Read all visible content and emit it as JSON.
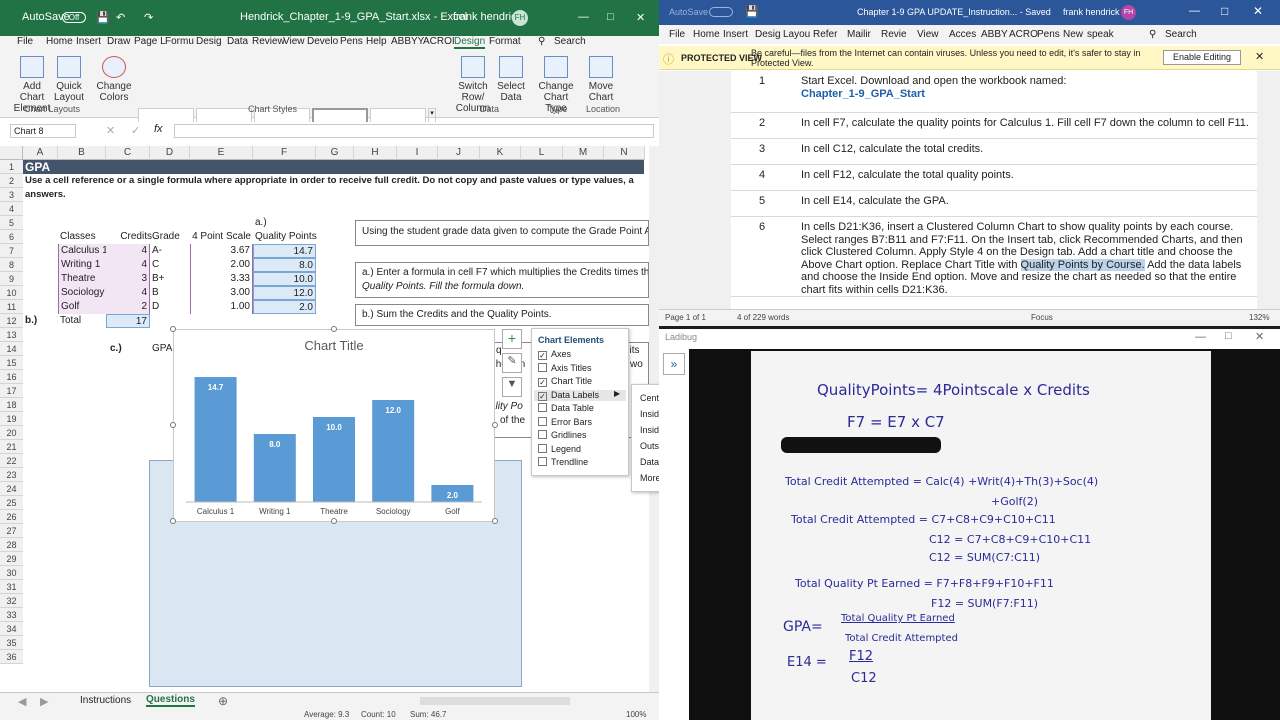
{
  "excel": {
    "autosave": "AutoSave",
    "autosave_state": "Off",
    "title": "Hendrick_Chapter_1-9_GPA_Start.xlsx - Excel",
    "user": "frank hendrick",
    "initials": "FH",
    "tabs": [
      "File",
      "Home",
      "Insert",
      "Draw",
      "Page L",
      "Formu",
      "Desig",
      "Data",
      "Review",
      "View",
      "Develo",
      "Pens",
      "Help",
      "ABBYY",
      "ACROI",
      "Design",
      "Format"
    ],
    "tell_me": "Search",
    "ribbon": {
      "add_chart": "Add Chart Element",
      "quick_layout": "Quick Layout",
      "change_colors": "Change Colors",
      "switch": "Switch Row/ Column",
      "select_data": "Select Data",
      "change_type": "Change Chart Type",
      "move_chart": "Move Chart",
      "groups": [
        "Chart Layouts",
        "Chart Styles",
        "Data",
        "Type",
        "Location"
      ]
    },
    "name_box": "Chart 8",
    "columns": [
      "A",
      "B",
      "C",
      "D",
      "E",
      "F",
      "G",
      "H",
      "I",
      "J",
      "K",
      "L",
      "M",
      "N"
    ],
    "rows": [
      "1",
      "2",
      "3",
      "4",
      "5",
      "6",
      "7",
      "8",
      "9",
      "10",
      "11",
      "12",
      "13",
      "14",
      "15",
      "16",
      "17",
      "18",
      "19",
      "20",
      "21",
      "22",
      "23",
      "24",
      "25",
      "26",
      "27",
      "28",
      "29",
      "30",
      "31",
      "32",
      "33",
      "34",
      "35",
      "36"
    ],
    "a1": "GPA",
    "a2": "Use a cell reference or a single formula where appropriate in order to receive full credit. Do not copy and paste values or type values, a",
    "a2b": "answers.",
    "e5": "a.)",
    "headers": [
      "Classes",
      "Credits",
      "Grade",
      "4 Point Scale",
      "Quality Points"
    ],
    "data": [
      {
        "cls": "Calculus 1",
        "cr": "4",
        "gr": "A-",
        "sc": "3.67",
        "qp": "14.7"
      },
      {
        "cls": "Writing 1",
        "cr": "4",
        "gr": "C",
        "sc": "2.00",
        "qp": "8.0"
      },
      {
        "cls": "Theatre",
        "cr": "3",
        "gr": "B+",
        "sc": "3.33",
        "qp": "10.0"
      },
      {
        "cls": "Sociology",
        "cr": "4",
        "gr": "B",
        "sc": "3.00",
        "qp": "12.0"
      },
      {
        "cls": "Golf",
        "cr": "2",
        "gr": "D",
        "sc": "1.00",
        "qp": "2.0"
      }
    ],
    "b12": "b.)",
    "total_label": "Total",
    "total_credits": "17",
    "c14": "c.)",
    "gpa_label": "GPA:",
    "instr1": "Using the student grade data given to compute the Grade Point A",
    "instr2a": "a.) Enter a formula in cell F7 which multiplies the Credits times th",
    "instr2b": "Quality Points. Fill the formula down.",
    "instr3": "b.) Sum the Credits and the Quality Points.",
    "frag1": "ng",
    "frag2": "y",
    "frag3": "q",
    "frag4": "dits",
    "frag5": "wo",
    "frag6": "y how m",
    "frag7": "ality Po",
    "frag8": "of the",
    "sheets": [
      "Instructions",
      "Questions"
    ],
    "status": {
      "average": "Average: 9.3",
      "count": "Count: 10",
      "sum": "Sum: 46.7",
      "zoom": "100%"
    }
  },
  "chart_elements": {
    "title": "Chart Elements",
    "items": [
      {
        "label": "Axes",
        "checked": true
      },
      {
        "label": "Axis Titles",
        "checked": false
      },
      {
        "label": "Chart Title",
        "checked": true
      },
      {
        "label": "Data Labels",
        "checked": true
      },
      {
        "label": "Data Table",
        "checked": false
      },
      {
        "label": "Error Bars",
        "checked": false
      },
      {
        "label": "Gridlines",
        "checked": false
      },
      {
        "label": "Legend",
        "checked": false
      },
      {
        "label": "Trendline",
        "checked": false
      }
    ],
    "submenu": [
      "Center",
      "Inside End",
      "Inside Base",
      "Outside End",
      "Data Callout",
      "More Options..."
    ]
  },
  "chart_data": {
    "type": "bar",
    "title": "Chart Title",
    "categories": [
      "Calculus 1",
      "Writing 1",
      "Theatre",
      "Sociology",
      "Golf"
    ],
    "values": [
      14.7,
      8.0,
      10.0,
      12.0,
      2.0
    ],
    "labels": [
      "14.7",
      "8.0",
      "10.0",
      "12.0",
      "2.0"
    ],
    "ylim": [
      0,
      16
    ],
    "color": "#5b9bd5"
  },
  "word": {
    "autosave": "AutoSave",
    "title": "Chapter 1-9 GPA UPDATE_Instruction... - Saved",
    "user": "frank hendrick",
    "initials": "FH",
    "tabs": [
      "File",
      "Home",
      "Insert",
      "Desig",
      "Layou",
      "Refer",
      "Mailir",
      "Revie",
      "View",
      "Acces",
      "ABBY",
      "ACRO",
      "Pens",
      "New",
      "speak"
    ],
    "search": "Search",
    "pv_label": "PROTECTED VIEW",
    "pv_text": "Be careful—files from the Internet can contain viruses. Unless you need to edit, it's safer to stay in Protected View.",
    "pv_button": "Enable Editing",
    "steps": [
      {
        "n": "1",
        "t": "Start Excel. Download and open the workbook named:",
        "link": "Chapter_1-9_GPA_Start"
      },
      {
        "n": "2",
        "t": "In cell F7, calculate the quality points for Calculus 1. Fill cell F7 down the column to cell F11."
      },
      {
        "n": "3",
        "t": "In cell C12, calculate the total credits."
      },
      {
        "n": "4",
        "t": "In cell F12, calculate the total quality points."
      },
      {
        "n": "5",
        "t": "In cell E14, calculate the GPA."
      },
      {
        "n": "6",
        "t1": "In cells D21:K36, insert a Clustered Column Chart to show quality points by each course. Select ranges B7:B11 and F7:F11. On the Insert tab, click Recommended Charts, and then click Clustered Column. Apply Style 4 on the Design tab. Add a chart title and choose the Above Chart option. Replace Chart Title with ",
        "hl": "Quality Points by Course.",
        "t2": " Add the data labels and choose the Inside End option. Move and resize the chart as needed so that the entire chart fits within cells D21:K36."
      }
    ],
    "status": {
      "page": "Page 1 of 1",
      "words": "4 of 229 words",
      "focus": "Focus",
      "zoom": "132%"
    }
  },
  "ladibug": {
    "title": "Ladibug",
    "lines": [
      "QualityPoints= 4Pointscale x Credits",
      "F7   =  E7 x C7",
      "Total Credit Attempted = Calc(4) +Writ(4)+Th(3)+Soc(4)",
      "+Golf(2)",
      "Total Credit Attempted  =  C7+C8+C9+C10+C11",
      "C12 = C7+C8+C9+C10+C11",
      "C12 = SUM(C7:C11)",
      "Total Quality Pt Earned = F7+F8+F9+F10+F11",
      "F12 = SUM(F7:F11)",
      "GPA=",
      "Total Quality Pt Earned",
      "Total Credit Attempted",
      "E14 =",
      "F12",
      "C12"
    ]
  }
}
